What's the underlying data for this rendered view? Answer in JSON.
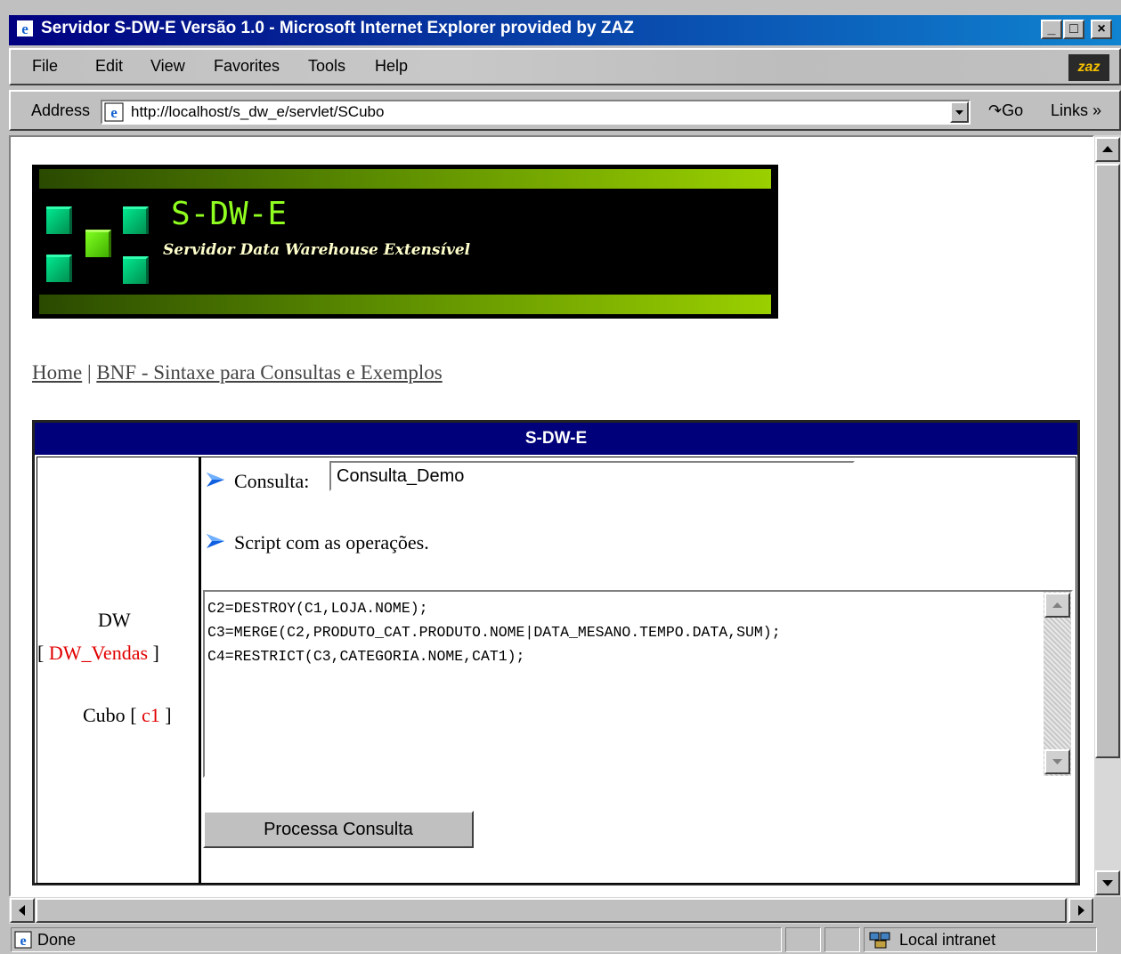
{
  "window": {
    "title": "Servidor S-DW-E Versão 1.0 - Microsoft Internet Explorer provided by ZAZ",
    "logo": "zaz"
  },
  "menu": {
    "items": [
      "File",
      "Edit",
      "View",
      "Favorites",
      "Tools",
      "Help"
    ]
  },
  "address": {
    "label": "Address",
    "url": "http://localhost/s_dw_e/servlet/SCubo",
    "go": "Go",
    "links": "Links"
  },
  "banner": {
    "title": "S-DW-E",
    "subtitle": "Servidor Data Warehouse Extensível"
  },
  "nav": {
    "home": "Home",
    "separator": "|",
    "bnf": "BNF - Sintaxe para Consultas e Exemplos"
  },
  "table": {
    "header": "S-DW-E",
    "dw_label": "DW",
    "dw_open": "[",
    "dw_value": "DW_Vendas",
    "dw_close": "]",
    "cubo_label": "Cubo",
    "cubo_open": "[",
    "cubo_value": "c1",
    "cubo_close": "]"
  },
  "form": {
    "consulta_label": "Consulta:",
    "consulta_value": "Consulta_Demo",
    "script_label": "Script com as operações.",
    "script_value": "C2=DESTROY(C1,LOJA.NOME);\nC3=MERGE(C2,PRODUTO_CAT.PRODUTO.NOME|DATA_MESANO.TEMPO.DATA,SUM);\nC4=RESTRICT(C3,CATEGORIA.NOME,CAT1);",
    "submit_label": "Processa Consulta"
  },
  "status": {
    "text": "Done",
    "zone": "Local intranet"
  }
}
